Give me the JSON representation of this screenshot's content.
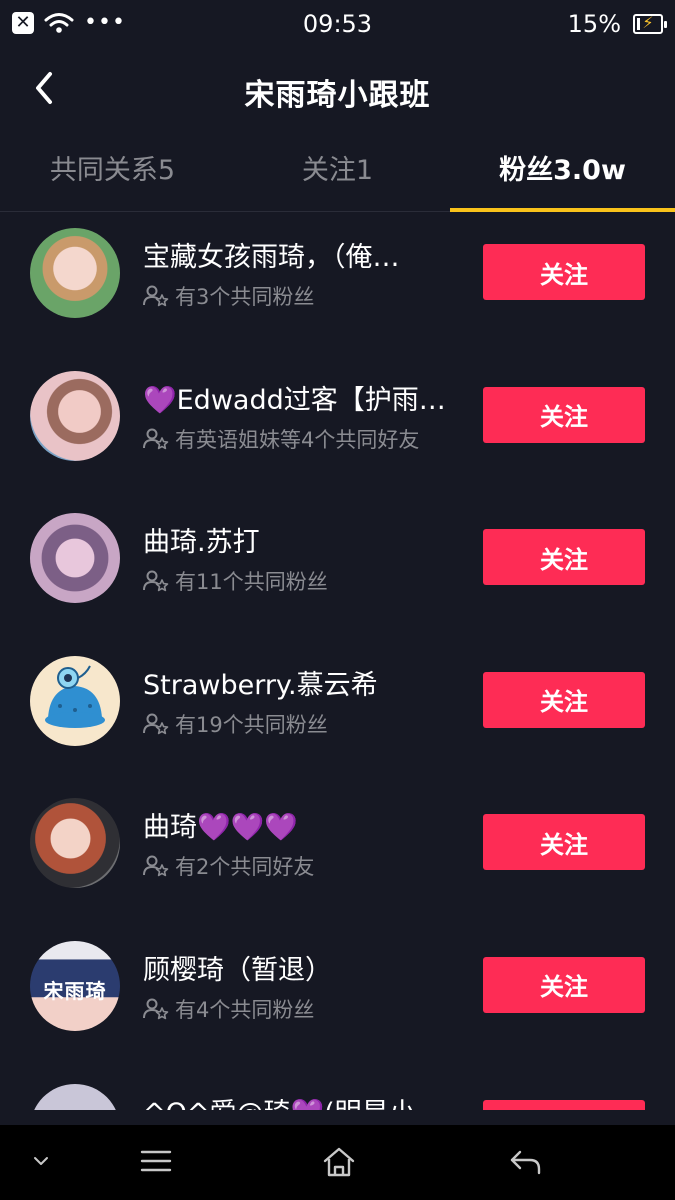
{
  "status_bar": {
    "time": "09:53",
    "battery_percent": "15%",
    "battery_level": 0.15,
    "left_close_symbol": "✕",
    "dots": "•••"
  },
  "header": {
    "title": "宋雨琦小跟班"
  },
  "tabs": [
    {
      "label": "共同关系5"
    },
    {
      "label": "关注1"
    },
    {
      "label": "粉丝3.0w"
    }
  ],
  "active_tab_index": 2,
  "users": [
    {
      "name": "宝藏女孩雨琦，（俺…",
      "mutual": "有3个共同粉丝",
      "button": "关注"
    },
    {
      "name": "💜Edwadd过客【护雨…",
      "mutual": "有英语姐妹等4个共同好友",
      "button": "关注"
    },
    {
      "name": "曲琦.苏打",
      "mutual": "有11个共同粉丝",
      "button": "关注"
    },
    {
      "name": "Strawberry.慕云希",
      "mutual": "有19个共同粉丝",
      "button": "关注"
    },
    {
      "name": "曲琦💜💜💜",
      "mutual": "有2个共同好友",
      "button": "关注"
    },
    {
      "name": "顾樱琦（暂退）",
      "mutual": "有4个共同粉丝",
      "button": "关注"
    },
    {
      "name": "^O^爱@琦💜(明星小…",
      "mutual": "",
      "button": "关注"
    }
  ],
  "avatar_texts": {
    "user6": "宋雨琦"
  },
  "colors": {
    "background": "#161823",
    "follow_button": "#fe2c55",
    "tab_indicator": "#f9c31b",
    "secondary_text": "#8a8b91"
  },
  "icons": {
    "back": "chevron-left-icon",
    "mutual": "user-group-icon",
    "nav_down": "chevron-down-icon",
    "nav_menu": "menu-icon",
    "nav_home": "home-icon",
    "nav_back": "back-arrow-icon"
  }
}
